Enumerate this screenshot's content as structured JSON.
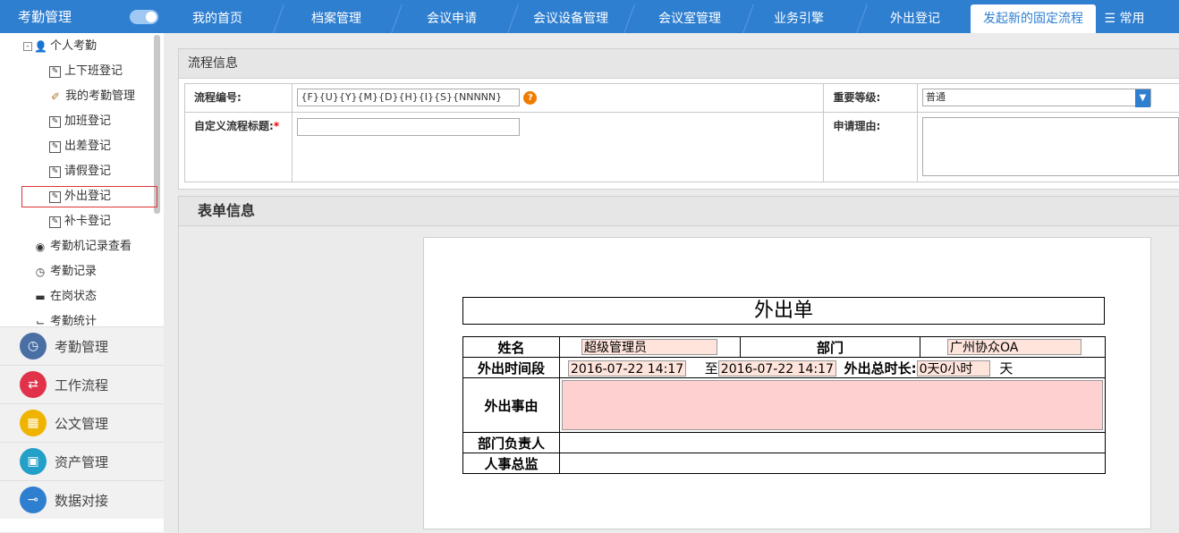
{
  "sidebar": {
    "title": "考勤管理",
    "tree": {
      "root": "个人考勤",
      "items": [
        "上下班登记",
        "我的考勤管理",
        "加班登记",
        "出差登记",
        "请假登记",
        "外出登记",
        "补卡登记"
      ],
      "sub_items": [
        "考勤机记录查看",
        "考勤记录",
        "在岗状态",
        "考勤统计"
      ]
    },
    "modules": [
      {
        "label": "考勤管理",
        "color": "#4a6fa5"
      },
      {
        "label": "工作流程",
        "color": "#e0334a"
      },
      {
        "label": "公文管理",
        "color": "#f0b400"
      },
      {
        "label": "资产管理",
        "color": "#22a0c8"
      },
      {
        "label": "数据对接",
        "color": "#2f7fd0"
      }
    ]
  },
  "tabs": [
    "我的首页",
    "档案管理",
    "会议申请",
    "会议设备管理",
    "会议室管理",
    "业务引擎",
    "外出登记",
    "发起新的固定流程"
  ],
  "tabs_extra": "常用",
  "flow_panel": {
    "title": "流程信息",
    "number_label": "流程编号:",
    "number_value": "{F}{U}{Y}{M}{D}{H}{I}{S}{NNNNN}",
    "custom_title_label": "自定义流程标题:",
    "required_mark": "*",
    "priority_label": "重要等级:",
    "priority_value": "普通",
    "reason_label": "申请理由:"
  },
  "form_panel": {
    "title": "表单信息",
    "form_title": "外出单",
    "name_label": "姓名",
    "name_value": "超级管理员",
    "dept_label": "部门",
    "dept_value": "广州协众OA",
    "period_label": "外出时间段",
    "start_time": "2016-07-22 14:17",
    "to_label": "至",
    "end_time": "2016-07-22 14:17",
    "duration_label": "外出总时长:",
    "duration_value": "0天0小时",
    "duration_unit": "天",
    "reason_label": "外出事由",
    "manager_label": "部门负责人",
    "hr_label": "人事总监"
  }
}
